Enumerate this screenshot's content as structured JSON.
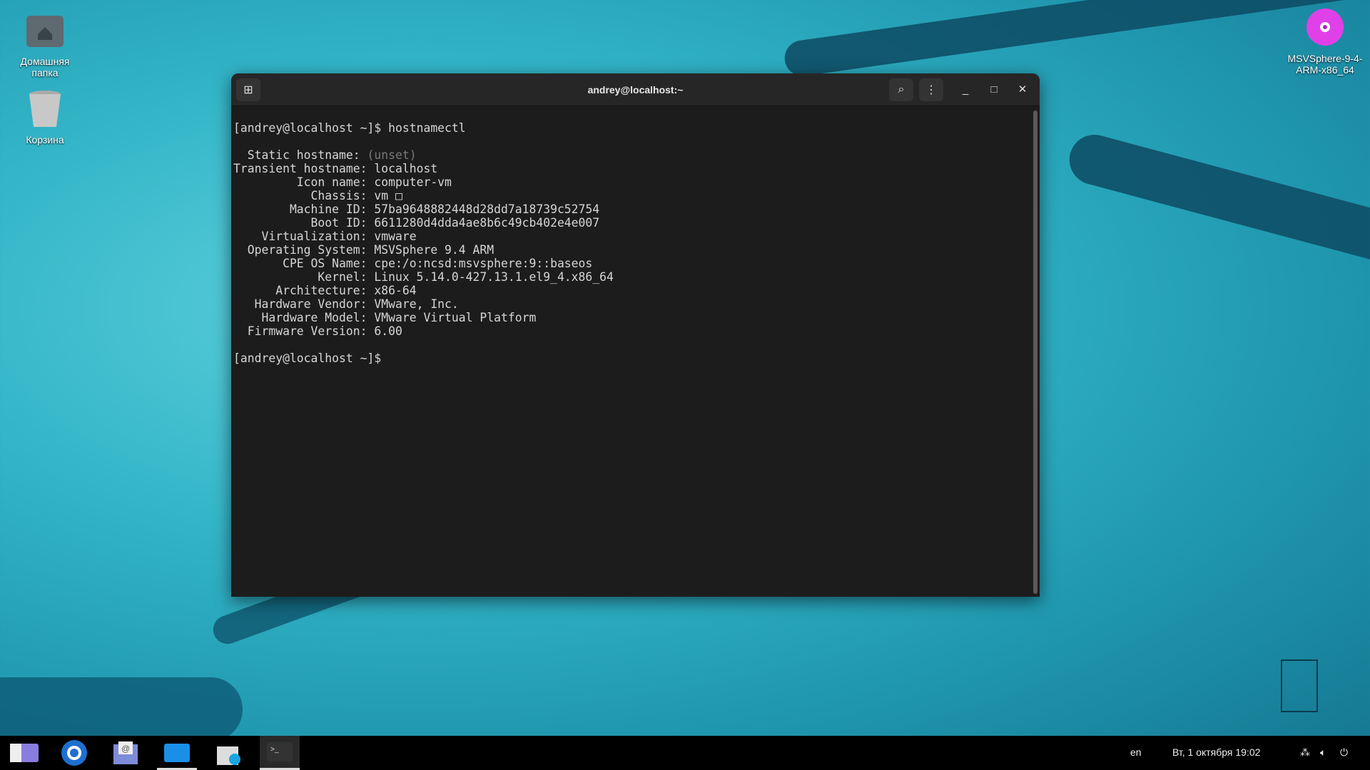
{
  "desktop": {
    "icons": [
      {
        "label": "Домашняя папка"
      },
      {
        "label": "Корзина"
      },
      {
        "label": "MSVSphere-9-4-ARM-x86_64"
      }
    ]
  },
  "terminal": {
    "title": "andrey@localhost:~",
    "prompt": "[andrey@localhost ~]$ ",
    "command": "hostnamectl",
    "lines": [
      {
        "label": "  Static hostname: ",
        "value": "(unset)",
        "dim": true
      },
      {
        "label": "Transient hostname: ",
        "value": "localhost"
      },
      {
        "label": "         Icon name: ",
        "value": "computer-vm"
      },
      {
        "label": "           Chassis: ",
        "value": "vm □"
      },
      {
        "label": "        Machine ID: ",
        "value": "57ba9648882448d28dd7a18739c52754"
      },
      {
        "label": "           Boot ID: ",
        "value": "6611280d4dda4ae8b6c49cb402e4e007"
      },
      {
        "label": "    Virtualization: ",
        "value": "vmware"
      },
      {
        "label": "  Operating System: ",
        "value": "MSVSphere 9.4 ARM"
      },
      {
        "label": "       CPE OS Name: ",
        "value": "cpe:/o:ncsd:msvsphere:9::baseos"
      },
      {
        "label": "            Kernel: ",
        "value": "Linux 5.14.0-427.13.1.el9_4.x86_64"
      },
      {
        "label": "      Architecture: ",
        "value": "x86-64"
      },
      {
        "label": "   Hardware Vendor: ",
        "value": "VMware, Inc."
      },
      {
        "label": "    Hardware Model: ",
        "value": "VMware Virtual Platform"
      },
      {
        "label": "  Firmware Version: ",
        "value": "6.00"
      }
    ]
  },
  "taskbar": {
    "apps": [
      "apps-menu",
      "browser",
      "mail",
      "files",
      "software-store",
      "terminal"
    ],
    "lang": "en",
    "clock": "Вт, 1 октября 19:02"
  }
}
